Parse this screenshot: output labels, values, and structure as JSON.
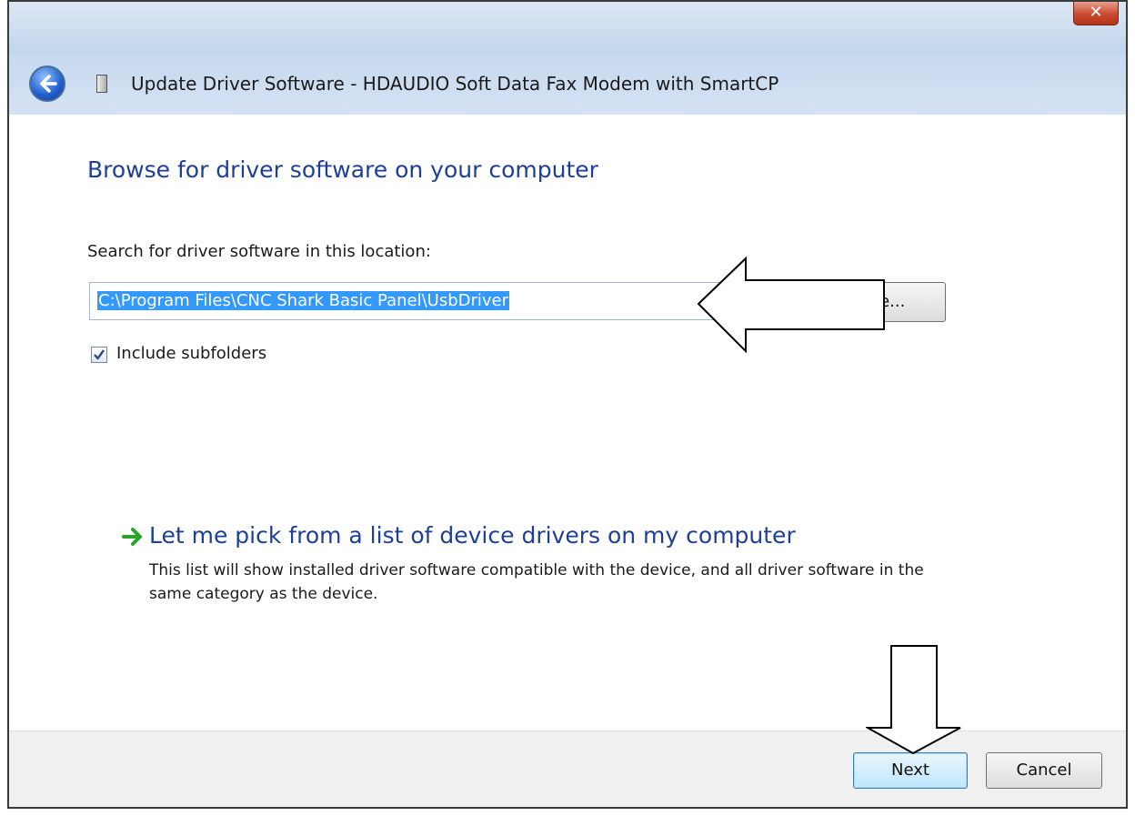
{
  "window": {
    "title": "Update Driver Software - HDAUDIO Soft Data Fax Modem with SmartCP",
    "close_glyph": "✕"
  },
  "page": {
    "heading": "Browse for driver software on your computer",
    "search_label": "Search for driver software in this location:",
    "path_value": "C:\\Program Files\\CNC Shark Basic Panel\\UsbDriver",
    "browse_label": "Browse...",
    "include_subfolders_label": "Include subfolders",
    "include_subfolders_checked": true,
    "pick_link": "Let me pick from a list of device drivers on my computer",
    "pick_description": "This list will show installed driver software compatible with the device, and all driver software in the same category as the device."
  },
  "footer": {
    "next_label": "Next",
    "cancel_label": "Cancel"
  },
  "icons": {
    "back": "back-arrow-icon",
    "device": "device-icon",
    "pick": "green-arrow-icon",
    "check": "checkmark-icon"
  },
  "colors": {
    "heading": "#1e3f99",
    "selection": "#3399ff",
    "link_arrow": "#2aa52a"
  }
}
